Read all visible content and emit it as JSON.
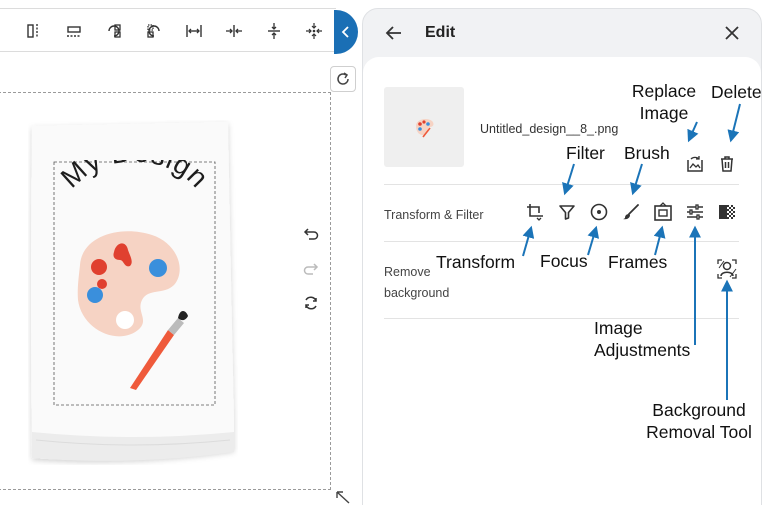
{
  "panel": {
    "title": "Edit",
    "back_icon": "arrow-left-icon",
    "close_icon": "close-icon"
  },
  "image": {
    "filename": "Untitled_design__8_.png"
  },
  "rows": {
    "transform_filter_label": "Transform & Filter",
    "remove_bg_line1": "Remove",
    "remove_bg_line2": "background"
  },
  "design": {
    "text": "My Design"
  },
  "annotations": {
    "replace_image_1": "Replace",
    "replace_image_2": "Image",
    "delete": "Delete",
    "filter": "Filter",
    "brush": "Brush",
    "transform": "Transform",
    "focus": "Focus",
    "frames": "Frames",
    "image_adjustments_1": "Image",
    "image_adjustments_2": "Adjustments",
    "background_removal_1": "Background",
    "background_removal_2": "Removal Tool"
  },
  "colors": {
    "accent": "#1a6fb5",
    "annotation_arrow": "#1b74b8",
    "palette": "#f6d3c4",
    "paint_red": "#e0402f",
    "paint_blue": "#3a8fdc",
    "brush_orange": "#ef5a3b"
  }
}
